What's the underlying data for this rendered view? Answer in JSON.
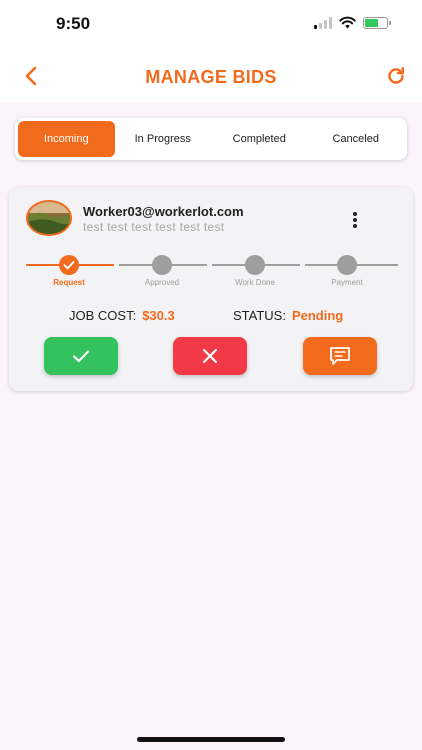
{
  "status_bar": {
    "time": "9:50",
    "battery_level": 0.6,
    "battery_color": "#34c759"
  },
  "nav": {
    "title": "MANAGE BIDS",
    "back_icon": "chevron-left-icon",
    "refresh_icon": "refresh-icon"
  },
  "tabs": [
    {
      "label": "Incoming",
      "active": true
    },
    {
      "label": "In Progress",
      "active": false
    },
    {
      "label": "Completed",
      "active": false
    },
    {
      "label": "Canceled",
      "active": false
    }
  ],
  "bid": {
    "email": "Worker03@workerlot.com",
    "description": "test test test test test test",
    "steps": [
      {
        "label": "Request",
        "done": true
      },
      {
        "label": "Approved",
        "done": false
      },
      {
        "label": "Work Done",
        "done": false
      },
      {
        "label": "Payment",
        "done": false
      }
    ],
    "job_cost_label": "JOB COST:",
    "job_cost_value": "$30.3",
    "status_label": "STATUS:",
    "status_value": "Pending",
    "actions": [
      {
        "name": "accept",
        "icon": "check-icon",
        "color": "#33c25e"
      },
      {
        "name": "reject",
        "icon": "close-icon",
        "color": "#f13a46"
      },
      {
        "name": "message",
        "icon": "message-icon",
        "color": "#f26a1b"
      }
    ]
  },
  "colors": {
    "accent": "#f26a1b",
    "background": "#fbf5fb",
    "card": "#f3f3f5",
    "inactive": "#9e9e9e"
  }
}
